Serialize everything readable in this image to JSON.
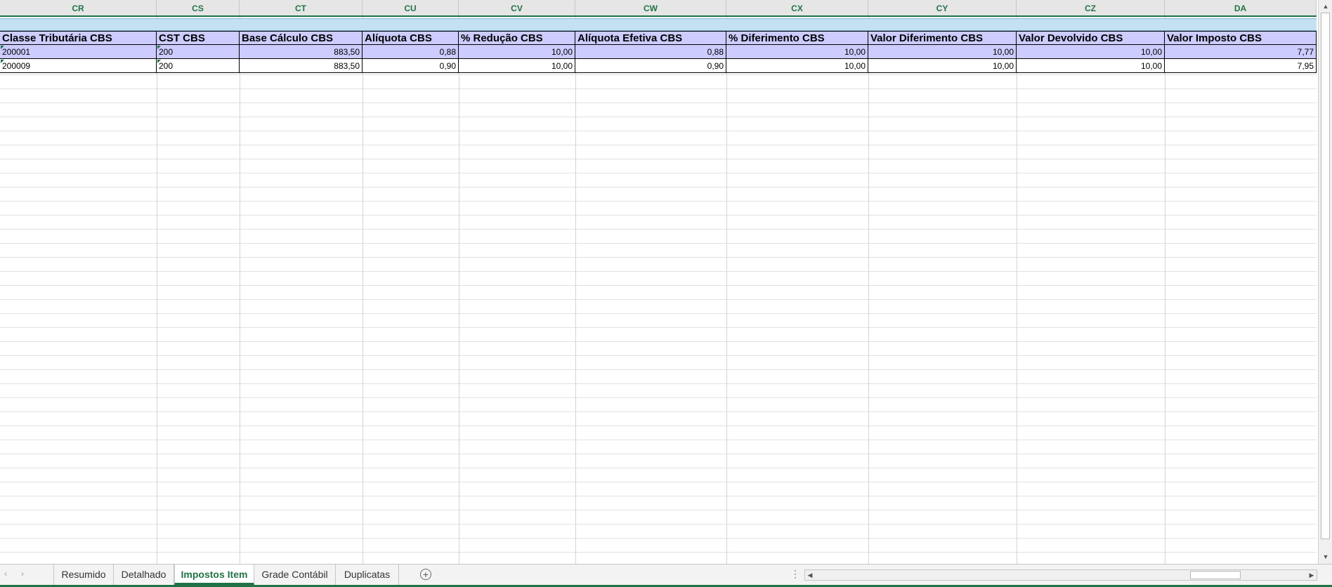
{
  "columns": [
    "CR",
    "CS",
    "CT",
    "CU",
    "CV",
    "CW",
    "CX",
    "CY",
    "CZ",
    "DA"
  ],
  "headers": [
    "Classe Tributária CBS",
    "CST CBS",
    "Base Cálculo CBS",
    "Alíquota CBS",
    "% Redução CBS",
    "Alíquota Efetiva CBS",
    "% Diferimento CBS",
    "Valor Diferimento CBS",
    "Valor Devolvido CBS",
    "Valor Imposto CBS"
  ],
  "rows": [
    [
      "200001",
      "200",
      "883,50",
      "0,88",
      "10,00",
      "0,88",
      "10,00",
      "10,00",
      "10,00",
      "7,77"
    ],
    [
      "200009",
      "200",
      "883,50",
      "0,90",
      "10,00",
      "0,90",
      "10,00",
      "10,00",
      "10,00",
      "7,95"
    ]
  ],
  "sheet_nav": {
    "prev": "‹",
    "next": "›"
  },
  "tabs": [
    "Resumido",
    "Detalhado",
    "Impostos Item",
    "Grade Contábil",
    "Duplicatas"
  ],
  "active_tab": "Impostos Item",
  "add_sheet": "+",
  "more_dots": "⋮",
  "scroll": {
    "up": "▲",
    "down": "▼",
    "left": "◀",
    "right": "▶"
  },
  "colors": {
    "accent": "#217346",
    "header_fill": "#ccccff",
    "band_fill": "#c5e0f0"
  }
}
